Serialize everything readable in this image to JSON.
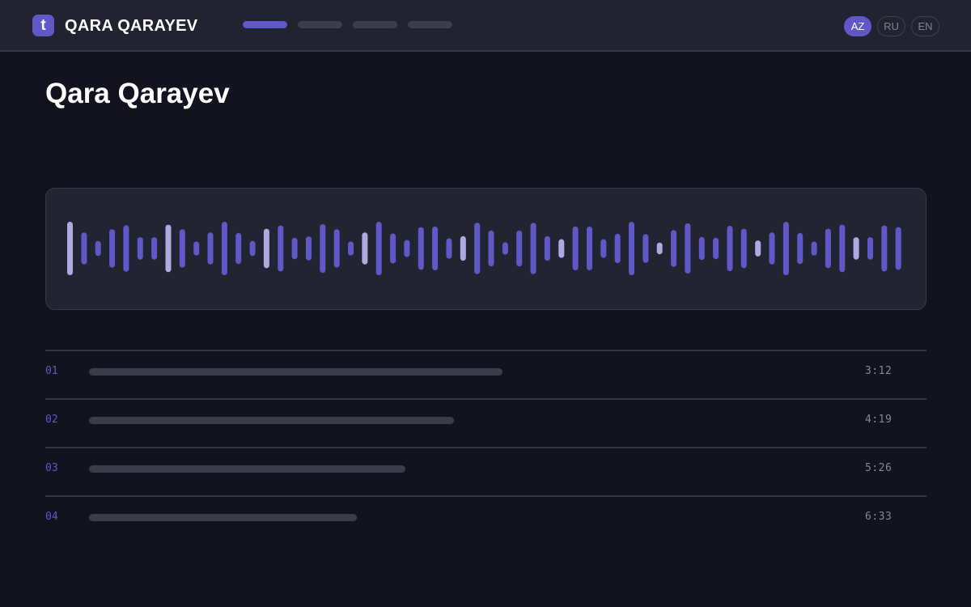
{
  "header": {
    "logo_letter": "t",
    "brand": "QARA QARAYEV",
    "nav": [
      {
        "active": true
      },
      {
        "active": false
      },
      {
        "active": false
      },
      {
        "active": false
      }
    ],
    "languages": [
      {
        "label": "AZ",
        "active": true
      },
      {
        "label": "RU",
        "active": false
      },
      {
        "label": "EN",
        "active": false
      }
    ]
  },
  "page": {
    "title": "Qara Qarayev"
  },
  "waveform": {
    "bars": [
      {
        "level": 1.0,
        "played": true
      },
      {
        "level": 0.6,
        "played": false
      },
      {
        "level": 0.28,
        "played": false
      },
      {
        "level": 0.72,
        "played": false
      },
      {
        "level": 0.87,
        "played": false
      },
      {
        "level": 0.42,
        "played": false
      },
      {
        "level": 0.42,
        "played": false
      },
      {
        "level": 0.89,
        "played": true
      },
      {
        "level": 0.72,
        "played": false
      },
      {
        "level": 0.26,
        "played": false
      },
      {
        "level": 0.6,
        "played": false
      },
      {
        "level": 1.0,
        "played": false
      },
      {
        "level": 0.58,
        "played": false
      },
      {
        "level": 0.28,
        "played": false
      },
      {
        "level": 0.74,
        "played": true
      },
      {
        "level": 0.86,
        "played": false
      },
      {
        "level": 0.4,
        "played": false
      },
      {
        "level": 0.45,
        "played": false
      },
      {
        "level": 0.91,
        "played": false
      },
      {
        "level": 0.72,
        "played": false
      },
      {
        "level": 0.26,
        "played": false
      },
      {
        "level": 0.6,
        "played": true
      },
      {
        "level": 1.0,
        "played": false
      },
      {
        "level": 0.56,
        "played": false
      },
      {
        "level": 0.32,
        "played": false
      },
      {
        "level": 0.8,
        "played": false
      },
      {
        "level": 0.82,
        "played": false
      },
      {
        "level": 0.38,
        "played": false
      },
      {
        "level": 0.46,
        "played": true
      },
      {
        "level": 0.96,
        "played": false
      },
      {
        "level": 0.67,
        "played": false
      },
      {
        "level": 0.23,
        "played": false
      },
      {
        "level": 0.67,
        "played": false
      },
      {
        "level": 0.96,
        "played": false
      },
      {
        "level": 0.46,
        "played": false
      },
      {
        "level": 0.35,
        "played": true
      },
      {
        "level": 0.82,
        "played": false
      },
      {
        "level": 0.82,
        "played": false
      },
      {
        "level": 0.35,
        "played": false
      },
      {
        "level": 0.55,
        "played": false
      },
      {
        "level": 1.0,
        "played": false
      },
      {
        "level": 0.54,
        "played": false
      },
      {
        "level": 0.22,
        "played": true
      },
      {
        "level": 0.69,
        "played": false
      },
      {
        "level": 0.94,
        "played": false
      },
      {
        "level": 0.43,
        "played": false
      },
      {
        "level": 0.4,
        "played": false
      },
      {
        "level": 0.85,
        "played": false
      },
      {
        "level": 0.74,
        "played": false
      },
      {
        "level": 0.3,
        "played": true
      },
      {
        "level": 0.6,
        "played": false
      },
      {
        "level": 1.0,
        "played": false
      },
      {
        "level": 0.58,
        "played": false
      },
      {
        "level": 0.26,
        "played": false
      },
      {
        "level": 0.74,
        "played": false
      },
      {
        "level": 0.89,
        "played": false
      },
      {
        "level": 0.42,
        "played": true
      },
      {
        "level": 0.42,
        "played": false
      },
      {
        "level": 0.86,
        "played": false
      },
      {
        "level": 0.8,
        "played": false
      }
    ]
  },
  "tracks": [
    {
      "number": "01",
      "bar_fraction": 0.469,
      "duration": "3:12"
    },
    {
      "number": "02",
      "bar_fraction": 0.414,
      "duration": "4:19"
    },
    {
      "number": "03",
      "bar_fraction": 0.359,
      "duration": "5:26"
    },
    {
      "number": "04",
      "bar_fraction": 0.304,
      "duration": "6:33"
    }
  ],
  "colors": {
    "accent": "#6058c7",
    "played": "#aeaadf",
    "page_bg": "#12131e",
    "panel_bg": "#232431"
  }
}
